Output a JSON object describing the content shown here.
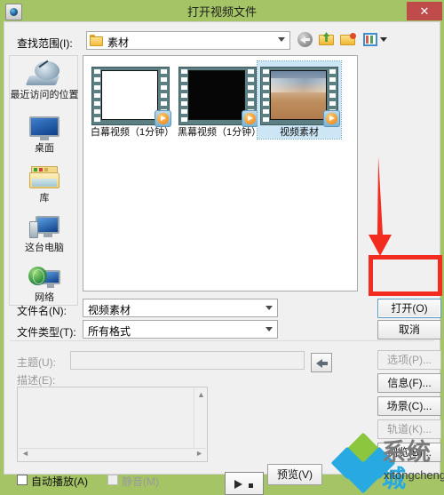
{
  "window": {
    "title": "打开视频文件",
    "app_icon": "camera-icon",
    "close_label": "✕"
  },
  "toolbar": {
    "lookin_label": "查找范围(I):",
    "lookin_value": "素材",
    "lookin_icon": "folder-icon",
    "buttons": [
      {
        "name": "back-button",
        "icon": "back-arrow-icon"
      },
      {
        "name": "up-one-level-button",
        "icon": "up-folder-icon"
      },
      {
        "name": "new-folder-button",
        "icon": "new-folder-icon"
      },
      {
        "name": "views-button",
        "icon": "views-grid-icon"
      }
    ]
  },
  "places": [
    {
      "name": "recent-places",
      "label": "最近访问的位置",
      "icon": "recent-places-icon"
    },
    {
      "name": "desktop",
      "label": "桌面",
      "icon": "desktop-monitor-icon"
    },
    {
      "name": "libraries",
      "label": "库",
      "icon": "libraries-folder-icon"
    },
    {
      "name": "this-pc",
      "label": "这台电脑",
      "icon": "computer-icon"
    },
    {
      "name": "network",
      "label": "网络",
      "icon": "network-globe-icon"
    }
  ],
  "files": [
    {
      "name": "白幕视频（1分钟）",
      "thumb": "white",
      "selected": false,
      "badge": "play-badge-icon"
    },
    {
      "name": "黑幕视频（1分钟）",
      "thumb": "black",
      "selected": false,
      "badge": "play-badge-icon"
    },
    {
      "name": "视频素材",
      "thumb": "photo",
      "selected": true,
      "badge": "play-badge-icon"
    }
  ],
  "fields": {
    "filename_label": "文件名(N):",
    "filename_value": "视频素材",
    "filetype_label": "文件类型(T):",
    "filetype_value": "所有格式",
    "subject_label": "主题(U):",
    "subject_value": "",
    "description_label": "描述(E):",
    "description_value": ""
  },
  "buttons": {
    "open": "打开(O)",
    "cancel": "取消",
    "options": "选项(P)...",
    "info": "信息(F)...",
    "scene": "场景(C)...",
    "track": "轨道(K)...",
    "browse": "浏览(B)...",
    "preview": "预览(V)"
  },
  "checkboxes": {
    "autoplay": "自动播放(A)",
    "mute": "静音(M)"
  },
  "player": {
    "play_icon": "play-triangle-icon",
    "stop_icon": "stop-square-icon"
  },
  "annotation": {
    "color": "#f22c1e",
    "arrow": "down-arrow-annotation",
    "highlight": "open-button-highlight-box"
  },
  "watermark": {
    "cn_left": "系统",
    "cn_right": "城",
    "en": "xitongcheng.com"
  },
  "colors": {
    "title_bar": "#a4c466",
    "close_button": "#bf4b4b",
    "selection": "#cce6f5",
    "accent_red": "#f22c1e"
  }
}
